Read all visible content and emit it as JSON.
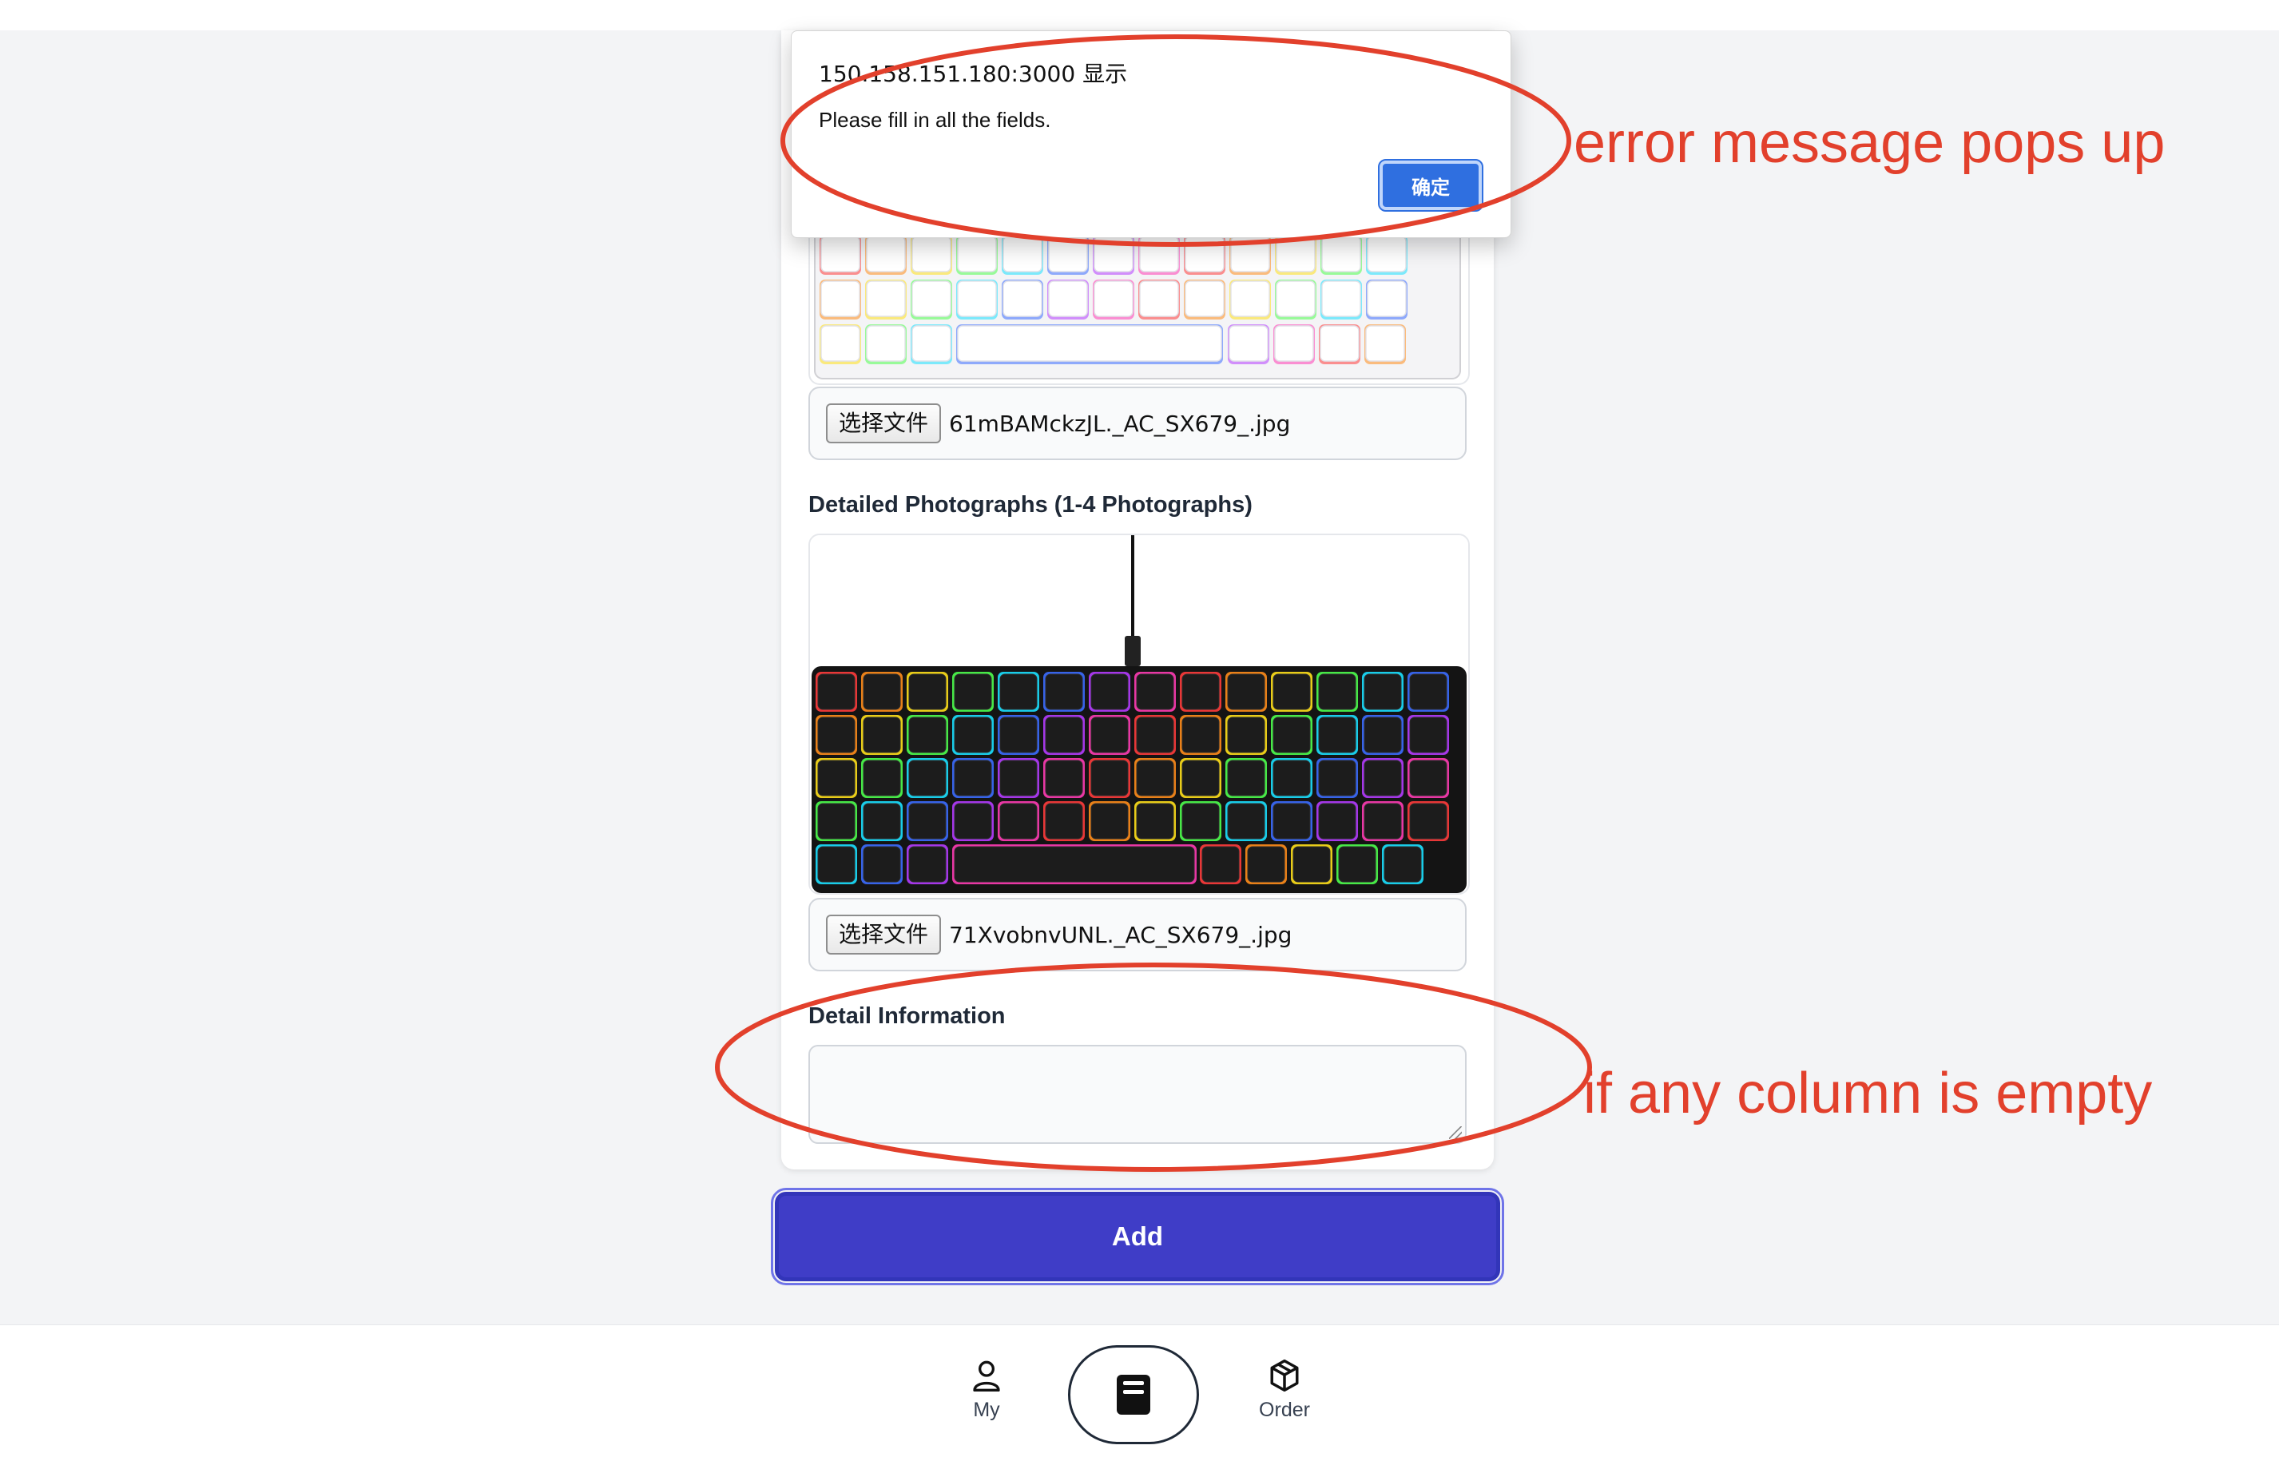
{
  "dialog": {
    "title": "150.158.151.180:3000 显示",
    "message": "Please fill in all the fields.",
    "ok_label": "确定"
  },
  "form": {
    "main_image": {
      "button_label": "选择文件",
      "file_name": "61mBAMckzJL._AC_SX679_.jpg"
    },
    "detail_photos_label": "Detailed Photographs (1-4 Photographs)",
    "detail_photo": {
      "button_label": "选择文件",
      "file_name": "71XvobnvUNL._AC_SX679_.jpg"
    },
    "detail_info_label": "Detail Information",
    "detail_info_value": "",
    "add_label": "Add"
  },
  "nav": {
    "items": [
      {
        "label": "My",
        "icon": "user-icon"
      },
      {
        "label": "",
        "icon": "document-icon"
      },
      {
        "label": "Order",
        "icon": "package-icon"
      }
    ]
  },
  "annotations": {
    "top": "error message pops up",
    "bottom": "if any column is empty",
    "color": "#e2402c"
  },
  "colors": {
    "accent": "#3f3dc7",
    "dialog_button": "#2f6fe0"
  }
}
